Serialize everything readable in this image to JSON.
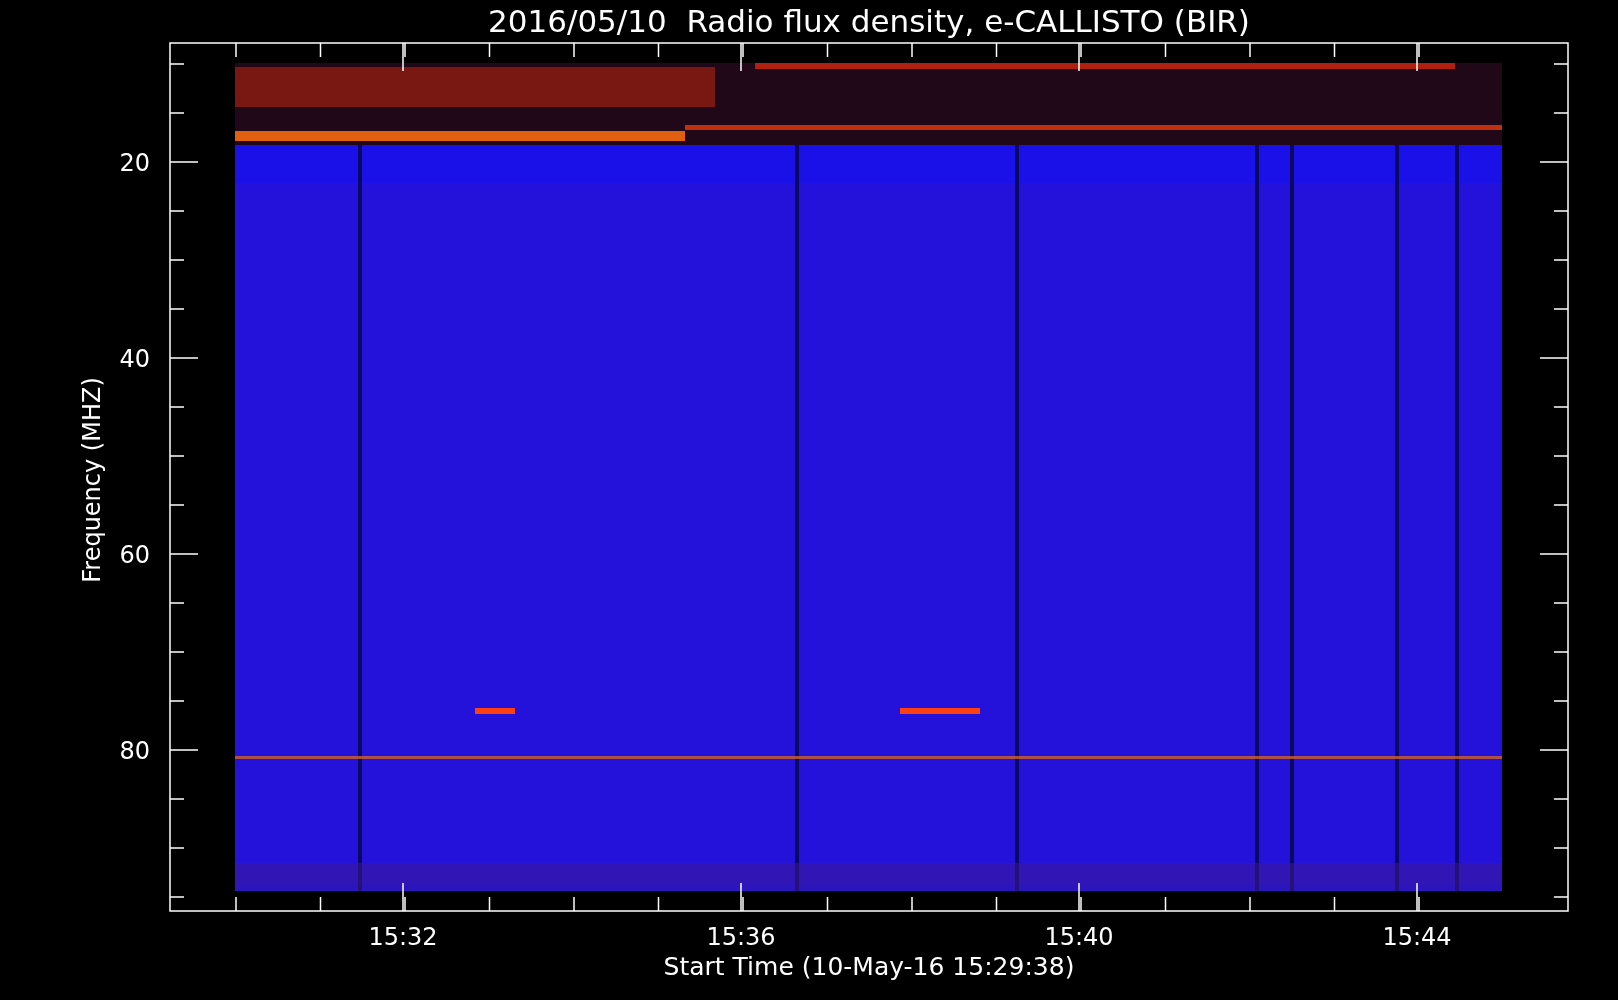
{
  "title": "2016/05/10  Radio flux density, e-CALLISTO (BIR)",
  "ylabel": "Frequency (MHZ)",
  "xlabel": "Start Time (10-May-16 15:29:38)",
  "yticks": [
    "20",
    "40",
    "60",
    "80"
  ],
  "xticks": [
    "15:32",
    "15:36",
    "15:40",
    "15:44"
  ]
}
